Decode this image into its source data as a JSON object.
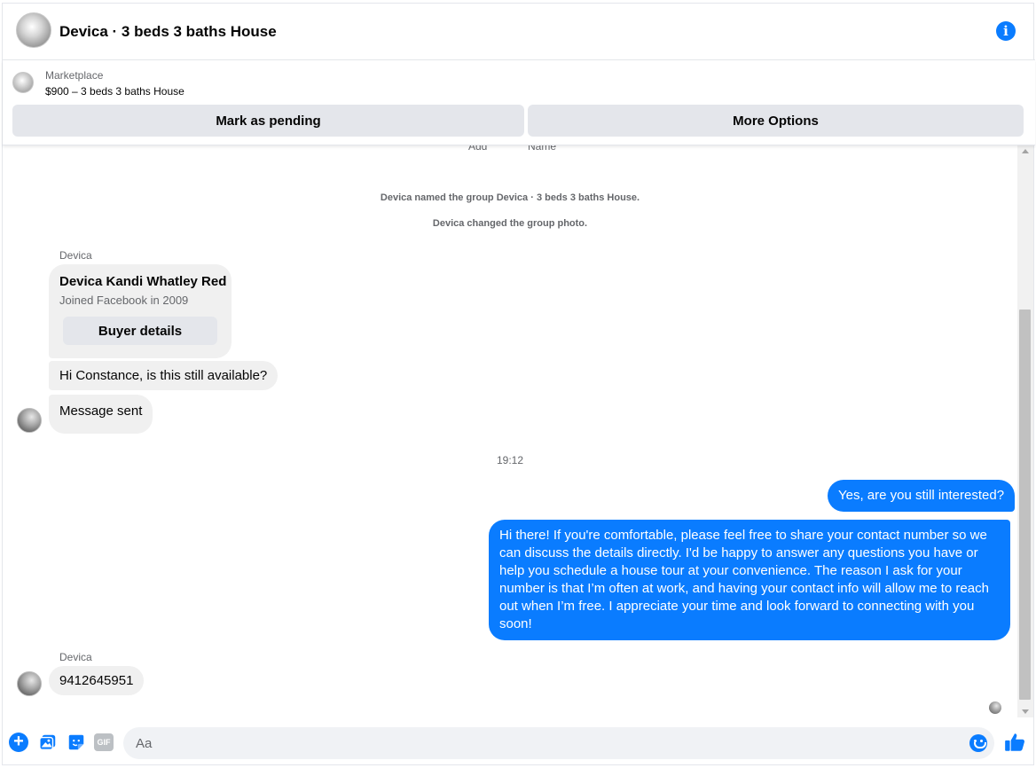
{
  "header": {
    "title": "Devica · 3 beds 3 baths House"
  },
  "marketplace": {
    "label": "Marketplace",
    "listing": "$900 – 3 beds 3 baths House",
    "mark_pending": "Mark as pending",
    "more_options": "More Options"
  },
  "chat": {
    "clipped_left": "Add",
    "clipped_right": "Name",
    "system_messages": [
      "Devica named the group Devica · 3 beds 3 baths House.",
      "Devica changed the group photo."
    ],
    "sender_name": "Devica",
    "buyer_card": {
      "name": "Devica Kandi Whatley Red",
      "joined": "Joined Facebook in 2009",
      "button": "Buyer details"
    },
    "incoming_1": "Hi Constance, is this still available?",
    "incoming_2": "Message sent",
    "timestamp": "19:12",
    "outgoing_1": "Yes, are you still interested?",
    "outgoing_2": "Hi there! If you're comfortable, please feel free to share your contact number so we can discuss the details directly. I'd be happy to answer any questions you have or help you schedule a house tour at your convenience. The reason I ask for your number is that I’m often at work, and having your contact info will allow me to reach out when I’m free. I appreciate your time and look forward to connecting with you soon!",
    "sender_name_2": "Devica",
    "incoming_3": "9412645951"
  },
  "composer": {
    "placeholder": "Aa",
    "gif_label": "GIF"
  },
  "colors": {
    "accent": "#0a7cff",
    "bubble_incoming": "#f0f0f0",
    "button_gray": "#e4e6eb"
  }
}
